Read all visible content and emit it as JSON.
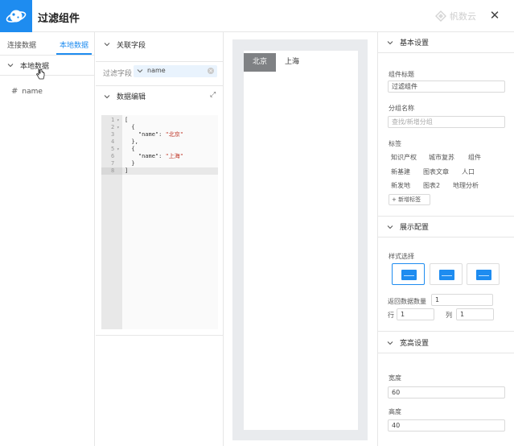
{
  "header": {
    "title": "过滤组件",
    "brand": "帆数云",
    "close": "✕"
  },
  "left": {
    "tabs": [
      "连接数据",
      "本地数据"
    ],
    "section": "本地数据",
    "fields": [
      {
        "icon": "#",
        "name": "name"
      }
    ]
  },
  "middle": {
    "related_title": "关联字段",
    "filter_label": "过滤字段",
    "filter_value": "name",
    "edit_title": "数据编辑",
    "code_lines": [
      {
        "n": "1",
        "fold": "▾",
        "text": "["
      },
      {
        "n": "2",
        "fold": "▾",
        "text": "  {"
      },
      {
        "n": "3",
        "fold": "",
        "key": "    \"name\": ",
        "val": "\"北京\""
      },
      {
        "n": "4",
        "fold": "",
        "text": "  },"
      },
      {
        "n": "5",
        "fold": "▾",
        "text": "  {"
      },
      {
        "n": "6",
        "fold": "",
        "key": "    \"name\": ",
        "val": "\"上海\""
      },
      {
        "n": "7",
        "fold": "",
        "text": "  }"
      },
      {
        "n": "8",
        "fold": "",
        "text": "]"
      }
    ]
  },
  "preview": {
    "tabs": [
      "北京",
      "上海"
    ]
  },
  "right": {
    "basic_title": "基本设置",
    "component_title_label": "组件标题",
    "component_title_value": "过滤组件",
    "group_label": "分组名称",
    "group_placeholder": "查找/新增分组",
    "tags_label": "标签",
    "tags": [
      "知识产权",
      "城市复苏",
      "组件",
      "新基建",
      "图表文章",
      "人口",
      "新发地",
      "图表2",
      "地理分析"
    ],
    "add_tag": "+ 新增标签",
    "display_title": "展示配置",
    "style_label": "样式选择",
    "return_count_label": "返回数据数量",
    "return_count_value": "1",
    "row_label": "行",
    "row_value": "1",
    "col_label": "列",
    "col_value": "1",
    "size_title": "宽高设置",
    "width_label": "宽度",
    "width_value": "60",
    "height_label": "高度",
    "height_value": "40"
  },
  "colors": {
    "accent": "#1e8cf0",
    "preview_active_tab": "#7f8184",
    "preview_bg": "#e9ebee"
  }
}
